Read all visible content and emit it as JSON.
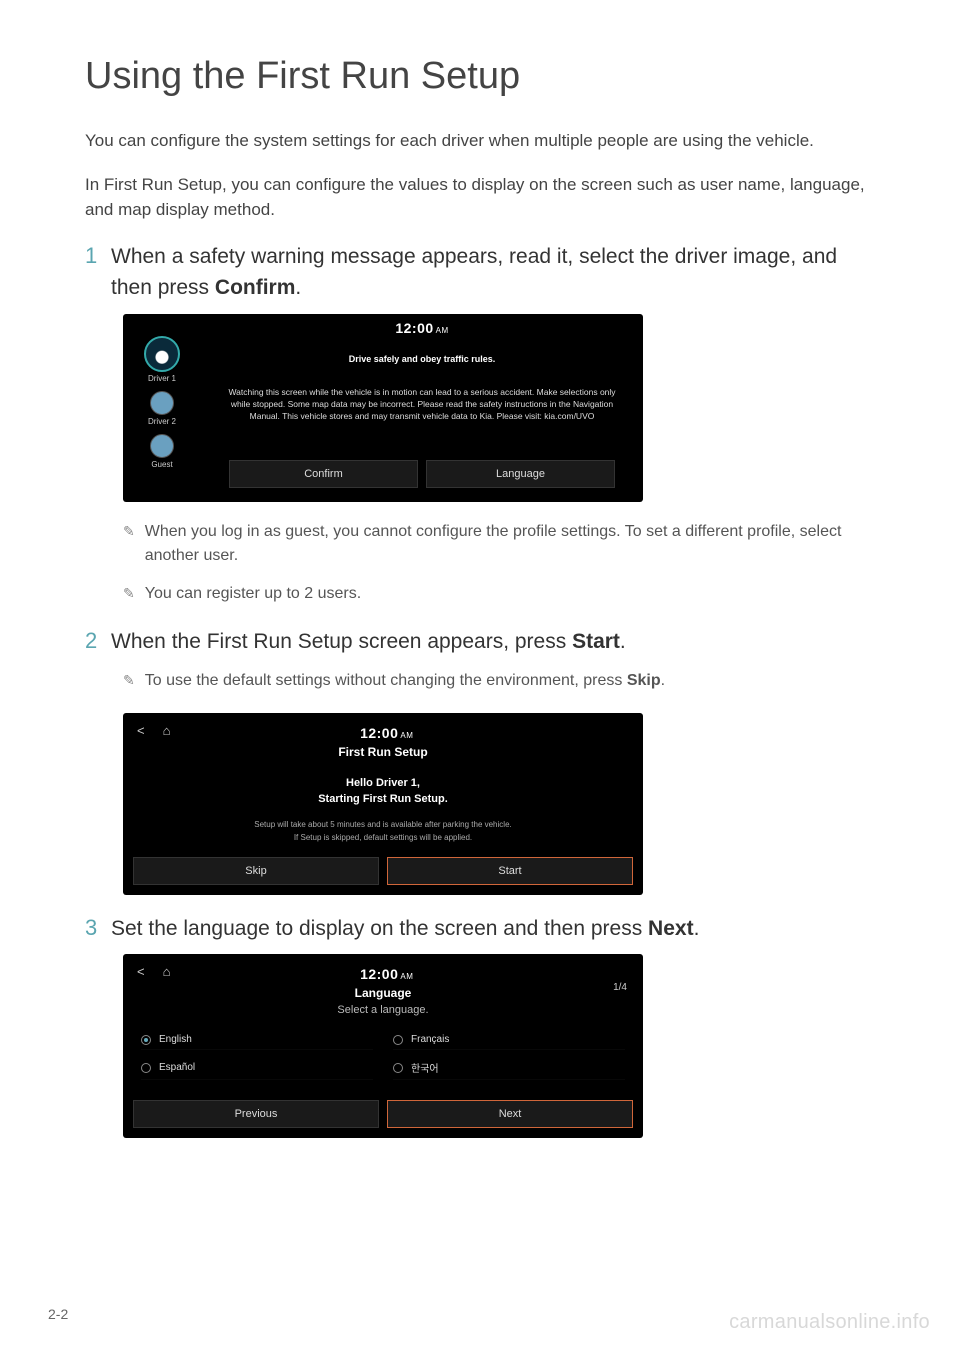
{
  "title": "Using the First Run Setup",
  "intro1": "You can configure the system settings for each driver when multiple people are using the vehicle.",
  "intro2": "In First Run Setup, you can configure the values to display on the screen such as user name, language, and map display method.",
  "step1": {
    "num": "1",
    "text_a": "When a safety warning message appears, read it, select the driver image, and then press ",
    "text_b": "Confirm",
    "text_c": "."
  },
  "step2": {
    "num": "2",
    "text_a": "When the First Run Setup screen appears, press ",
    "text_b": "Start",
    "text_c": "."
  },
  "step3": {
    "num": "3",
    "text_a": "Set the language to display on the screen and then press ",
    "text_b": "Next",
    "text_c": "."
  },
  "notes1": [
    "When you log in as guest, you cannot configure the profile settings. To set a different profile, select another user.",
    "You can register up to 2 users."
  ],
  "notes2": {
    "a": "To use the default settings without changing the environment, press ",
    "b": "Skip",
    "c": "."
  },
  "clock": {
    "time": "12:00",
    "ampm": "AM"
  },
  "screen1": {
    "drivers": [
      "Driver 1",
      "Driver 2",
      "Guest"
    ],
    "heading": "Drive safely and obey traffic rules.",
    "body": "Watching this screen while the vehicle is in motion can lead to a serious accident. Make selections only while stopped. Some map data may be incorrect. Please read the safety instructions in the Navigation Manual. This vehicle stores and may transmit vehicle data to Kia. Please visit: kia.com/UVO",
    "confirm": "Confirm",
    "language": "Language"
  },
  "screen2": {
    "title": "First Run Setup",
    "hello": "Hello Driver 1,",
    "starting": "Starting First Run Setup.",
    "note1": "Setup will take about 5 minutes and is available after parking the vehicle.",
    "note2": "If Setup is skipped, default settings will be applied.",
    "skip": "Skip",
    "start": "Start"
  },
  "screen3": {
    "title": "Language",
    "sub": "Select a language.",
    "pager": "1/4",
    "opts": [
      "English",
      "Français",
      "Español",
      "한국어"
    ],
    "selected": 0,
    "previous": "Previous",
    "next": "Next"
  },
  "page_num": "2-2",
  "watermark": "carmanualsonline.info"
}
